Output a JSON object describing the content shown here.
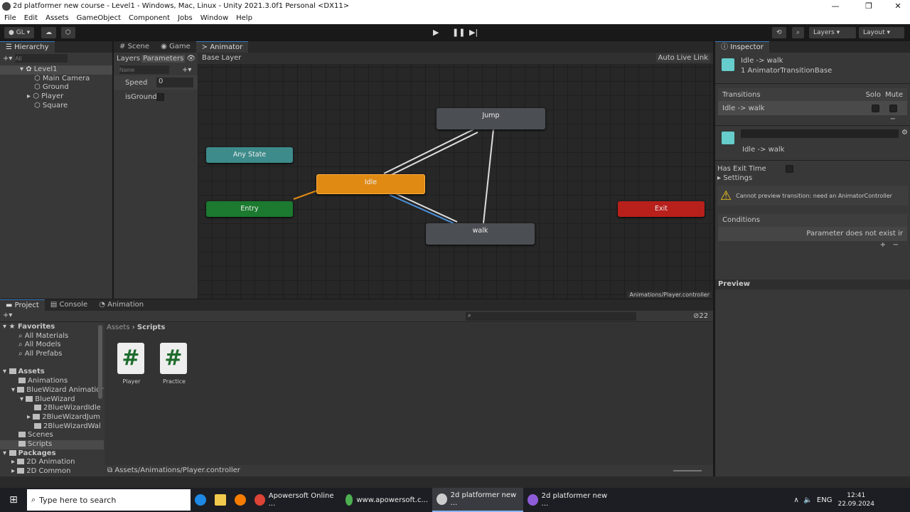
{
  "window": {
    "title": "2d platformer new course - Level1 - Windows, Mac, Linux - Unity 2021.3.0f1 Personal <DX11>"
  },
  "menu": [
    "File",
    "Edit",
    "Assets",
    "GameObject",
    "Component",
    "Jobs",
    "Window",
    "Help"
  ],
  "toolbar": {
    "account": "GL",
    "layers": "Layers",
    "layout": "Layout"
  },
  "hierarchy": {
    "tab": "Hierarchy",
    "search_placeholder": "All",
    "items": [
      "Level1",
      "Main Camera",
      "Ground",
      "Player",
      "Square"
    ]
  },
  "center_tabs": [
    "Scene",
    "Game",
    "Animator"
  ],
  "animator": {
    "subtabs": [
      "Layers",
      "Parameters"
    ],
    "breadcrumb": "Base Layer",
    "auto_live_link": "Auto Live Link",
    "search_placeholder": "Name",
    "parameters": [
      {
        "name": "Speed",
        "value": "0"
      },
      {
        "name": "isGrounde",
        "value": ""
      }
    ],
    "states": {
      "any": "Any State",
      "entry": "Entry",
      "idle": "Idle",
      "jump": "Jump",
      "walk": "walk",
      "exit": "Exit"
    },
    "path": "Animations/Player.controller",
    "colors": {
      "any": "#3d8b8b",
      "entry": "#1b7a2f",
      "idle": "#e08a14",
      "exit": "#b8201c",
      "default": "#4b4f54"
    }
  },
  "inspector": {
    "tab": "Inspector",
    "title": "Idle -> walk",
    "subtitle": "1 AnimatorTransitionBase",
    "transitions_label": "Transitions",
    "solo": "Solo",
    "mute": "Mute",
    "transition_item": "Idle -> walk",
    "name_value": "",
    "transition_name": "Idle -> walk",
    "has_exit_time": "Has Exit Time",
    "settings": "Settings",
    "warning": "Cannot preview transition: need an AnimatorController",
    "conditions": "Conditions",
    "condition_item": "Parameter does not exist ir",
    "preview": "Preview"
  },
  "bottom_tabs": [
    "Project",
    "Console",
    "Animation"
  ],
  "project": {
    "favorites": "Favorites",
    "fav_items": [
      "All Materials",
      "All Models",
      "All Prefabs"
    ],
    "assets": "Assets",
    "asset_tree": [
      "Animations",
      "BlueWizard Animatior",
      "BlueWizard",
      "2BlueWizardIdle",
      "2BlueWizardJum",
      "2BlueWizardWal",
      "Scenes",
      "Scripts"
    ],
    "packages": "Packages",
    "package_items": [
      "2D Animation",
      "2D Common"
    ],
    "breadcrumb": [
      "Assets",
      "Scripts"
    ],
    "files": [
      "Player",
      "Practice"
    ],
    "hidden_count": "22",
    "status_path": "Assets/Animations/Player.controller"
  },
  "taskbar": {
    "search": "Type here to search",
    "apps": [
      "Apowersoft Online ...",
      "www.apowersoft.c...",
      "2d platformer new ...",
      "2d platformer new ..."
    ],
    "lang": "ENG",
    "time": "12:41",
    "date": "22.09.2024"
  }
}
